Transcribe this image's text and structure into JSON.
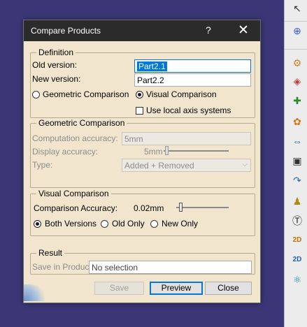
{
  "dialog": {
    "title": "Compare Products",
    "help_label": "?",
    "close_glyph": "✕"
  },
  "definition": {
    "legend": "Definition",
    "old_version_label": "Old version:",
    "old_version_value": "Part2.1",
    "new_version_label": "New version:",
    "new_version_value": "Part2.2",
    "mode_geometric_label": "Geometric Comparison",
    "mode_visual_label": "Visual Comparison",
    "mode_selected": "visual",
    "use_local_axis_label": "Use local axis systems",
    "use_local_axis_checked": false
  },
  "geometric": {
    "legend": "Geometric Comparison",
    "computation_accuracy_label": "Computation accuracy:",
    "computation_accuracy_value": "5mm",
    "display_accuracy_label": "Display accuracy:",
    "display_accuracy_value": "5mm",
    "type_label": "Type:",
    "type_value": "Added + Removed"
  },
  "visual": {
    "legend": "Visual Comparison",
    "accuracy_label": "Comparison Accuracy:",
    "accuracy_value": "0.02mm",
    "options": [
      "Both Versions",
      "Old Only",
      "New Only"
    ],
    "selected_option": "Both Versions"
  },
  "result": {
    "legend": "Result",
    "save_label": "Save in Product",
    "save_value": "No selection"
  },
  "buttons": {
    "save": "Save",
    "preview": "Preview",
    "close": "Close"
  },
  "toolbar": {
    "icons": [
      "select-arrow-icon",
      "zoom-select-icon",
      "gear-compare-icon",
      "product-icon",
      "assembly-icon",
      "constraint-icon",
      "move-arrows-icon",
      "clash-icon",
      "hook-icon",
      "text-annotation-icon",
      "2d-view-icon",
      "2d-layout-icon",
      "measure-icon"
    ]
  },
  "colors": {
    "background": "#3b3776",
    "dialog_bg": "#f1e5cd",
    "titlebar": "#2b2b2b",
    "selection": "#0078d7"
  }
}
